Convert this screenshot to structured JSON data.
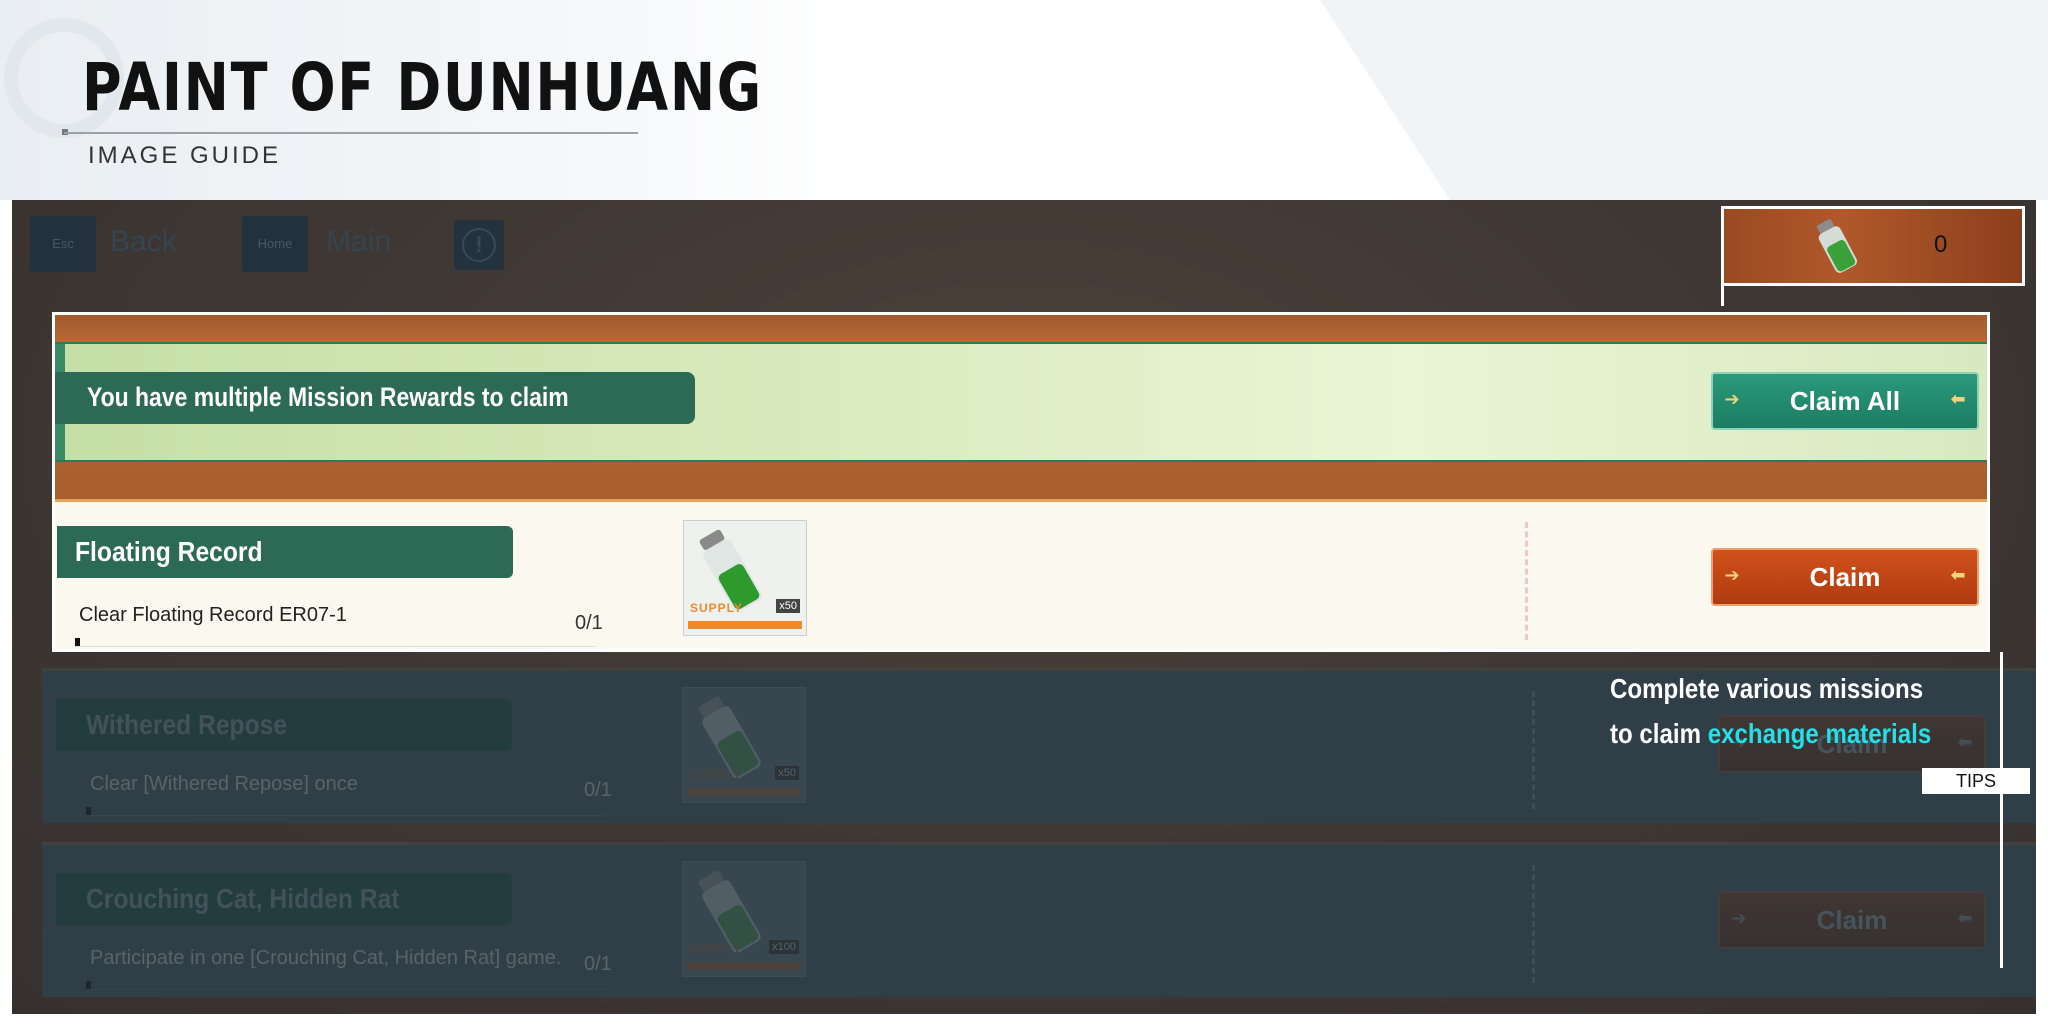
{
  "header": {
    "title": "PAINT OF DUNHUANG",
    "subtitle": "IMAGE GUIDE"
  },
  "top_bar": {
    "back_key": "Esc",
    "back_label": "Back",
    "main_key": "Home",
    "main_label": "Main",
    "info_glyph": "!"
  },
  "currency": {
    "icon": "green-vial-icon",
    "count": "0"
  },
  "claim_all": {
    "message": "You have multiple Mission Rewards to claim",
    "button_label": "Claim All"
  },
  "missions": [
    {
      "title": "Floating Record",
      "description": "Clear Floating Record ER07-1",
      "progress": "0/1",
      "progress_fraction": 0,
      "reward_qty": "x50",
      "reward_tag": "SUPPLY",
      "button_label": "Claim"
    },
    {
      "title": "Withered Repose",
      "description": "Clear [Withered Repose] once",
      "progress": "0/1",
      "progress_fraction": 0,
      "reward_qty": "x50",
      "reward_tag": "SUPPLY",
      "button_label": "Claim"
    },
    {
      "title": "Crouching Cat, Hidden Rat",
      "description": "Participate in one [Crouching Cat, Hidden Rat] game.",
      "progress": "0/1",
      "progress_fraction": 0,
      "reward_qty": "x100",
      "reward_tag": "SUPPLY",
      "button_label": "Claim"
    }
  ],
  "tips": {
    "line1": "Complete various missions",
    "line2_prefix": "to claim ",
    "line2_highlight": "exchange materials",
    "tag": "TIPS"
  },
  "colors": {
    "accent_green": "#2d6a55",
    "claim_orange": "#c5461a",
    "highlight_cyan": "#23dfe8"
  }
}
